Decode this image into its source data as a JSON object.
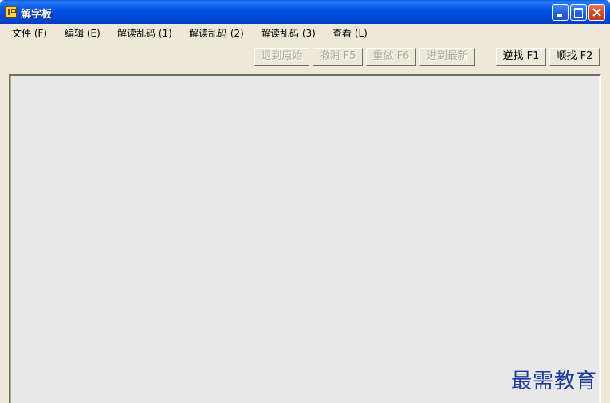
{
  "window": {
    "title": "解字板"
  },
  "menu": {
    "items": [
      {
        "label": "文件 (F)"
      },
      {
        "label": "编辑 (E)"
      },
      {
        "label": "解读乱码 (1)"
      },
      {
        "label": "解读乱码 (2)"
      },
      {
        "label": "解读乱码 (3)"
      },
      {
        "label": "查看 (L)"
      }
    ]
  },
  "toolbar": {
    "revert_original": "退到原始",
    "undo": "撤消 F5",
    "redo": "重做 F6",
    "go_latest": "进到最新",
    "find_reverse": "逆找 F1",
    "find_forward": "顺找 F2"
  },
  "editor": {
    "content": ""
  },
  "watermark": {
    "text": "最需教育"
  },
  "colors": {
    "titlebar": "#0055e5",
    "window_bg": "#ece9d8",
    "editor_bg": "#e8e8e8",
    "watermark": "#1f3b9a",
    "disabled_text": "#aca899"
  },
  "icons": {
    "app": "app-icon",
    "minimize": "minimize-icon",
    "maximize": "maximize-icon",
    "close": "close-icon"
  }
}
